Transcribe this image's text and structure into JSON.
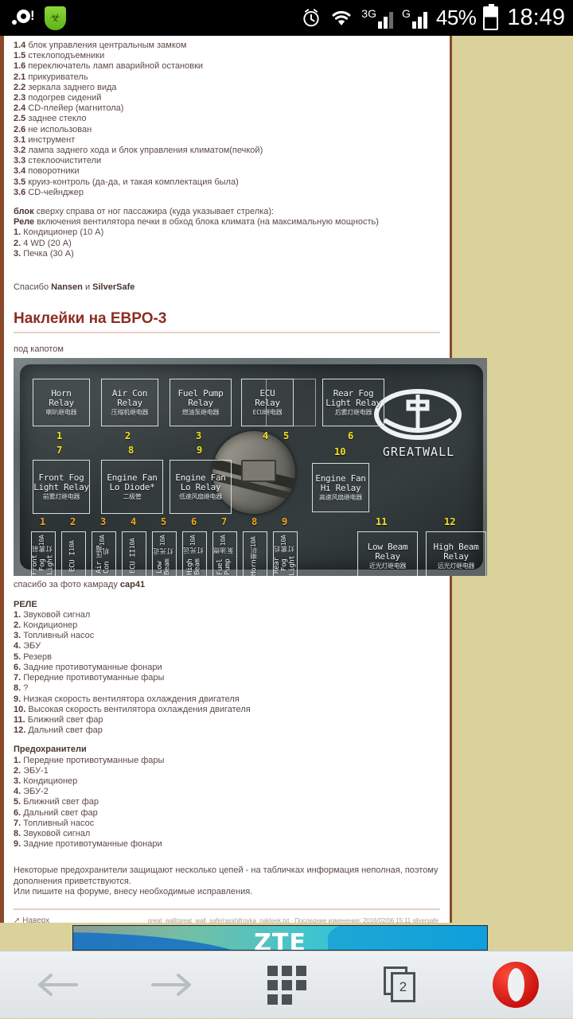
{
  "statusbar": {
    "icons": [
      "opera-mini-icon",
      "drweb-shield-icon",
      "alarm-icon",
      "wifi-icon",
      "signal-3g-icon",
      "signal-g-icon"
    ],
    "network_3g_label": "3G",
    "network_g_label": "G",
    "battery_percent": "45%",
    "clock": "18:49"
  },
  "page": {
    "fuse_list_top": [
      {
        "n": "1.4",
        "text": "блок управления центральным замком"
      },
      {
        "n": "1.5",
        "text": "стеклоподъемники"
      },
      {
        "n": "1.6",
        "text": "переключатель ламп аварийной остановки"
      },
      {
        "n": "2.1",
        "text": "прикуриватель"
      },
      {
        "n": "2.2",
        "text": "зеркала заднего вида"
      },
      {
        "n": "2.3",
        "text": "подогрев сидений"
      },
      {
        "n": "2.4",
        "text": "CD-плейер (магнитола)"
      },
      {
        "n": "2.5",
        "text": "заднее стекло"
      },
      {
        "n": "2.6",
        "text": "не использован"
      },
      {
        "n": "3.1",
        "text": "инструмент"
      },
      {
        "n": "3.2",
        "text": "лампа заднего хода и блок управления климатом(печкой)"
      },
      {
        "n": "3.3",
        "text": "стеклоочистители"
      },
      {
        "n": "3.4",
        "text": "поворотники"
      },
      {
        "n": "3.5",
        "text": "круиз-контроль (да-да, и такая комплектация была)"
      },
      {
        "n": "3.6",
        "text": "CD-чейнджер"
      }
    ],
    "block_intro_bold": "блок",
    "block_intro_rest": " сверху справа от ног пассажира (куда указывает стрелка):",
    "relay_intro_bold": "Реле",
    "relay_intro_rest": " включения вентилятора печки в обход блока климата (на максимальную мощность)",
    "block_list": [
      {
        "n": "1.",
        "text": "Кондиционер (10 А)"
      },
      {
        "n": "2.",
        "text": "4 WD (20 А)"
      },
      {
        "n": "3.",
        "text": "Печка (30 А)"
      }
    ],
    "thanks_prefix": "Спасибо ",
    "thanks_name1": "Nansen",
    "thanks_mid": " и ",
    "thanks_name2": "SilverSafe",
    "section_title": "Наклейки на ЕВРО-3",
    "photo_caption": "под капотом",
    "photo_credit_prefix": "спасибо за фото камраду ",
    "photo_credit_name": "cap41",
    "relays_heading": "РЕЛЕ",
    "relays_list": [
      {
        "n": "1.",
        "text": "Звуковой сигнал"
      },
      {
        "n": "2.",
        "text": "Кондиционер"
      },
      {
        "n": "3.",
        "text": "Топливный насос"
      },
      {
        "n": "4.",
        "text": "ЭБУ"
      },
      {
        "n": "5.",
        "text": "Резерв"
      },
      {
        "n": "6.",
        "text": "Задние противотуманные фонари"
      },
      {
        "n": "7.",
        "text": "Передние противотуманные фары"
      },
      {
        "n": "8.",
        "text": "?"
      },
      {
        "n": "9.",
        "text": "Низкая скорость вентилятора охлаждения двигателя"
      },
      {
        "n": "10.",
        "text": "Высокая скорость вентилятора охлаждения двигателя"
      },
      {
        "n": "11.",
        "text": "Ближний свет фар"
      },
      {
        "n": "12.",
        "text": "Дальний свет фар"
      }
    ],
    "fuses_heading": "Предохранители",
    "fuses_list": [
      {
        "n": "1.",
        "text": "Передние противотуманные фары"
      },
      {
        "n": "2.",
        "text": "ЭБУ-1"
      },
      {
        "n": "3.",
        "text": "Кондиционер"
      },
      {
        "n": "4.",
        "text": "ЭБУ-2"
      },
      {
        "n": "5.",
        "text": "Ближний свет фар"
      },
      {
        "n": "6.",
        "text": "Дальний свет фар"
      },
      {
        "n": "7.",
        "text": "Топливный насос"
      },
      {
        "n": "8.",
        "text": "Звуковой сигнал"
      },
      {
        "n": "9.",
        "text": "Задние противотуманные фонари"
      }
    ],
    "note_line1": "Некоторые предохранители защищают несколько цепей - на табличках информация неполная, поэтому",
    "note_line2": "дополнения приветствуются.",
    "note_line3": "Или пишите на форуме, внесу необходимые исправления.",
    "footer_top_link": "Наверх",
    "footer_path": "great_wall/great_wall_safe/rasshifrovka_nakleek.txt · Последние изменения: 2016/02/06 15:11 silversafe"
  },
  "fusebox_photo": {
    "brand": "GREATWALL",
    "relay_labels_row1": [
      {
        "en1": "Horn",
        "en2": "Relay",
        "cn": "喇叭继电器",
        "num": "1"
      },
      {
        "en1": "Air Con",
        "en2": "Relay",
        "cn": "压缩机继电器",
        "num": "2"
      },
      {
        "en1": "Fuel Pump",
        "en2": "Relay",
        "cn": "燃油泵继电器",
        "num": "3"
      },
      {
        "en1": "ECU",
        "en2": "Relay",
        "cn": "ECU继电器",
        "num": "4"
      },
      {
        "en1": "",
        "en2": "",
        "cn": "",
        "num": "5"
      },
      {
        "en1": "Rear Fog",
        "en2": "Light Relay",
        "cn": "后雾灯继电器",
        "num": "6"
      }
    ],
    "relay_labels_row2": [
      {
        "en1": "Front Fog",
        "en2": "Light Relay",
        "cn": "前雾灯继电器",
        "num": "7"
      },
      {
        "en1": "Engine Fan",
        "en2": "Lo Diode*",
        "cn": "二极管",
        "num": "8"
      },
      {
        "en1": "Engine Fan",
        "en2": "Lo Relay",
        "cn": "低速风扇继电器",
        "num": "9"
      },
      {
        "en1": "Engine Fan",
        "en2": "Hi Relay",
        "cn": "高速风扇继电器",
        "num": "10"
      },
      {
        "en1": "Low Beam",
        "en2": "Relay",
        "cn": "近光灯继电器",
        "num": "11"
      },
      {
        "en1": "High Beam",
        "en2": "Relay",
        "cn": "远光灯继电器",
        "num": "12"
      }
    ],
    "fuse_labels": [
      {
        "en": "Front Fog Light",
        "amp": "10A",
        "cn": "前雾灯",
        "num": "1"
      },
      {
        "en": "ECU I",
        "amp": "10A",
        "cn": "",
        "num": "2"
      },
      {
        "en": "Air Con",
        "amp": "10A",
        "cn": "压缩机",
        "num": "3"
      },
      {
        "en": "ECU II",
        "amp": "10A",
        "cn": "",
        "num": "4"
      },
      {
        "en": "Low Beam",
        "amp": "10A",
        "cn": "近光灯",
        "num": "5"
      },
      {
        "en": "High Beam",
        "amp": "10A",
        "cn": "远光灯",
        "num": "6"
      },
      {
        "en": "Fuel Pump",
        "amp": "10A",
        "cn": "燃油泵",
        "num": "7"
      },
      {
        "en": "Horn",
        "amp": "10A",
        "cn": "喇叭",
        "num": "8"
      },
      {
        "en": "Rear Fog Light",
        "amp": "10A",
        "cn": "后雾灯",
        "num": "9"
      }
    ]
  },
  "ad": {
    "text": "ZTE"
  },
  "navbar": {
    "back_label": "back-arrow",
    "forward_label": "forward-arrow",
    "speeddial_label": "speed-dial",
    "tabs_count": "2",
    "opera_label": "opera-menu"
  }
}
